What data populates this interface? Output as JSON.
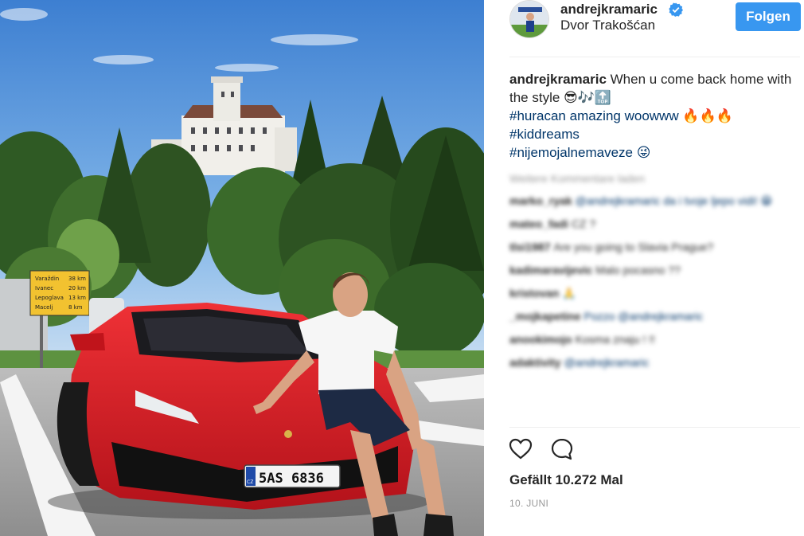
{
  "post": {
    "username": "andrejkramaric",
    "location": "Dvor Trakošćan",
    "follow_label": "Folgen",
    "verified_icon": "verified-badge-icon",
    "plate_text": "5AS 6836",
    "plate_country": "CZ"
  },
  "caption": {
    "username": "andrejkramaric",
    "text": "When u come back home with the style 😎🎶🔝",
    "hashtags": [
      "#huracan amazing woowww 🔥🔥🔥",
      "#kiddreams",
      "#nijemojalnemaveze 😜"
    ]
  },
  "comments": {
    "load_more": "Weitere Kommentare laden",
    "items": [
      {
        "user": "marko_ryak",
        "text": "@andrejkramaric da i tvoje ljepo vidi! 😁"
      },
      {
        "user": "mateo_fadi",
        "text": "CZ ?"
      },
      {
        "user": "tlsi1987",
        "text": "Are you going to Slavia Prague?"
      },
      {
        "user": "kadimaravijevic",
        "text": "Malo pocasno ??"
      },
      {
        "user": "kristovan",
        "text": "🙏"
      },
      {
        "user": "_mojkapetine",
        "text": "Pozzo @andrejkramaric"
      },
      {
        "user": "anookimojo",
        "text": "Kosma znaju ! !!"
      },
      {
        "user": "adaktivity",
        "text": "@andrejkramaric"
      }
    ]
  },
  "actions": {
    "like_icon": "heart-icon",
    "comment_icon": "comment-icon"
  },
  "likes_text": "Gefällt 10.272 Mal",
  "date_text": "10. JUNI",
  "sign": {
    "rows": [
      {
        "place": "Varaždin",
        "dist": "38 km"
      },
      {
        "place": "Ivanec",
        "dist": "20 km"
      },
      {
        "place": "Lepoglava",
        "dist": "13 km"
      },
      {
        "place": "Macelj",
        "dist": "8 km"
      }
    ]
  },
  "colors": {
    "accent": "#3897f0",
    "hashtag": "#003569",
    "car": "#d81a1e",
    "sky": "#4a8ad6"
  }
}
